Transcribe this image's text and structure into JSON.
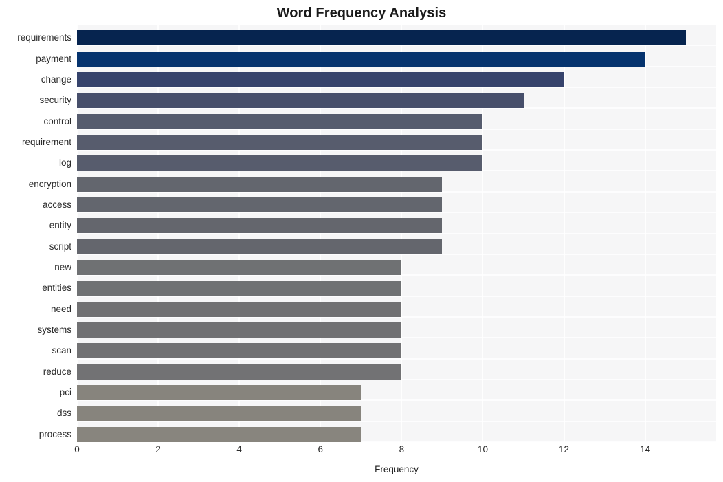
{
  "chart_data": {
    "type": "bar",
    "orientation": "horizontal",
    "title": "Word Frequency Analysis",
    "xlabel": "Frequency",
    "ylabel": "",
    "xlim": [
      0,
      15.75
    ],
    "xticks": [
      0,
      2,
      4,
      6,
      8,
      10,
      12,
      14
    ],
    "xtick_labels": [
      "0",
      "2",
      "4",
      "6",
      "8",
      "10",
      "12",
      "14"
    ],
    "grid": true,
    "legend": false,
    "categories": [
      "requirements",
      "payment",
      "change",
      "security",
      "control",
      "requirement",
      "log",
      "encryption",
      "access",
      "entity",
      "script",
      "new",
      "entities",
      "need",
      "systems",
      "scan",
      "reduce",
      "pci",
      "dss",
      "process"
    ],
    "values": [
      15,
      14,
      12,
      11,
      10,
      10,
      10,
      9,
      9,
      9,
      9,
      8,
      8,
      8,
      8,
      8,
      8,
      7,
      7,
      7
    ],
    "bar_colors": [
      "#06244f",
      "#05336e",
      "#36436c",
      "#474f6b",
      "#565c6e",
      "#575c6d",
      "#575c6d",
      "#63666e",
      "#63666e",
      "#64666d",
      "#64666d",
      "#6f7173",
      "#6f7173",
      "#717173",
      "#717173",
      "#727274",
      "#727274",
      "#87847d",
      "#87847d",
      "#88857e"
    ],
    "plot_background": "#f6f6f7",
    "gridline_color": "#ffffff",
    "title_color": "#1a1a1a",
    "tick_color": "#2b2b2b"
  }
}
